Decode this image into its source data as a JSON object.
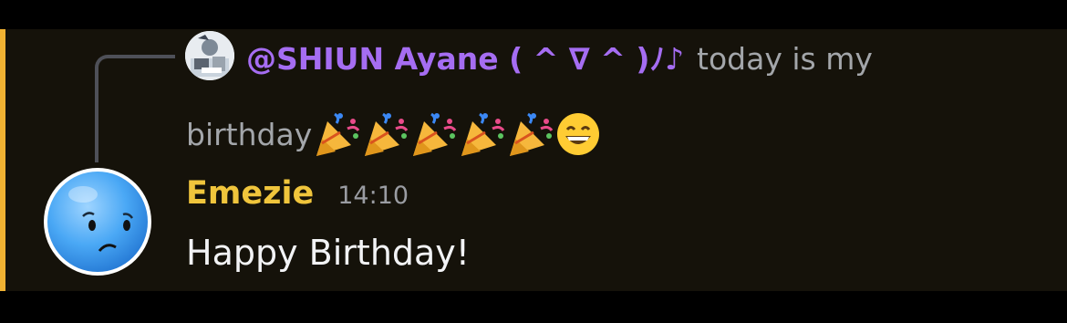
{
  "reply": {
    "author": "@SHIUN Ayane ( ^ ∇ ^ )ﾉ♪",
    "text_start": "today is my",
    "text_end": "birthday",
    "emojis": [
      "party-popper-emoji",
      "party-popper-emoji",
      "party-popper-emoji",
      "party-popper-emoji",
      "party-popper-emoji",
      "grinning-face-emoji"
    ]
  },
  "message": {
    "author": "Emezie",
    "timestamp": "14:10",
    "content": "Happy Birthday!"
  },
  "colors": {
    "highlight_bar": "#f0b232",
    "reply_author": "#a56df2",
    "author": "#f0c53c",
    "background": "#15120a"
  }
}
